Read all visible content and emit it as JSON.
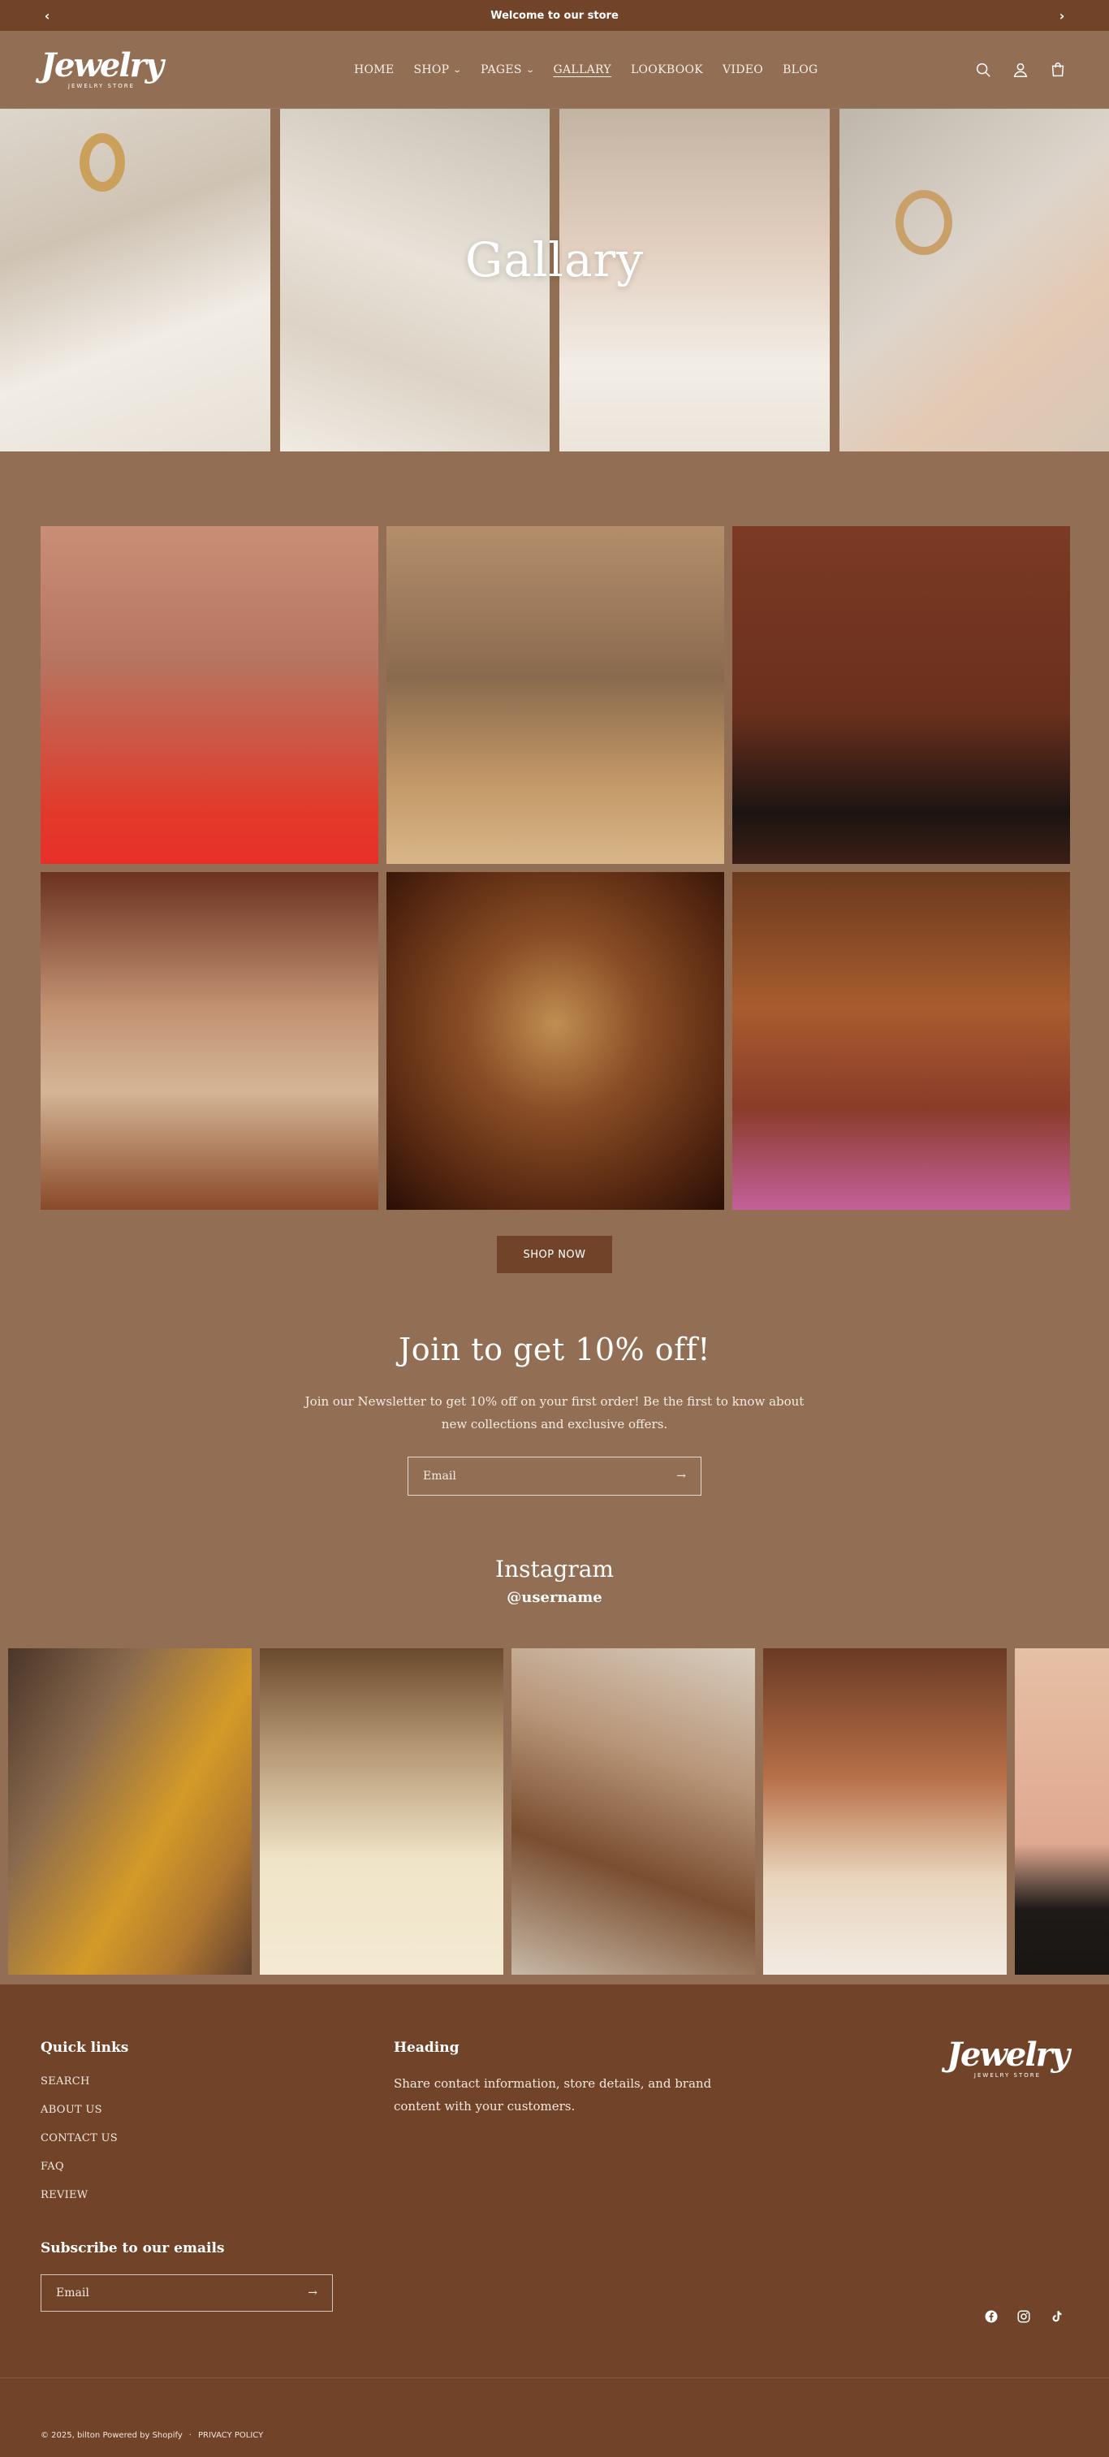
{
  "announcement": {
    "text": "Welcome to our store",
    "prev": "‹",
    "next": "›"
  },
  "brand": {
    "logo": "Jewelry",
    "tagline": "JEWELRY STORE"
  },
  "nav": [
    {
      "label": "HOME",
      "dropdown": false,
      "active": false
    },
    {
      "label": "SHOP",
      "dropdown": true,
      "active": false
    },
    {
      "label": "PAGES",
      "dropdown": true,
      "active": false
    },
    {
      "label": "GALLARY",
      "dropdown": false,
      "active": true
    },
    {
      "label": "LOOKBOOK",
      "dropdown": false,
      "active": false
    },
    {
      "label": "VIDEO",
      "dropdown": false,
      "active": false
    },
    {
      "label": "BLOG",
      "dropdown": false,
      "active": false
    }
  ],
  "header_icons": [
    "search-icon",
    "account-icon",
    "cart-icon"
  ],
  "hero": {
    "title": "Gallary"
  },
  "shop_button": "SHOP NOW",
  "newsletter": {
    "title": "Join to get 10% off!",
    "text": "Join our Newsletter to get 10% off on your first order! Be the first to know about new collections and exclusive offers.",
    "placeholder": "Email",
    "arrow": "→"
  },
  "instagram": {
    "title": "Instagram",
    "handle": "@username"
  },
  "footer": {
    "quick_links_title": "Quick links",
    "links": [
      "SEARCH",
      "ABOUT US",
      "CONTACT US",
      "FAQ",
      "REVIEW"
    ],
    "heading_title": "Heading",
    "heading_text": "Share contact information, store details, and brand content with your customers.",
    "subscribe_title": "Subscribe to our emails",
    "email_placeholder": "Email",
    "arrow": "→",
    "copyright": "© 2025, bilton Powered by Shopify",
    "separator": "·",
    "privacy": "PRIVACY POLICY",
    "social_icons": [
      "facebook-icon",
      "instagram-icon",
      "tiktok-icon"
    ]
  },
  "colors": {
    "bg": "#926e54",
    "dark": "#71442a",
    "text": "#ffffff"
  }
}
